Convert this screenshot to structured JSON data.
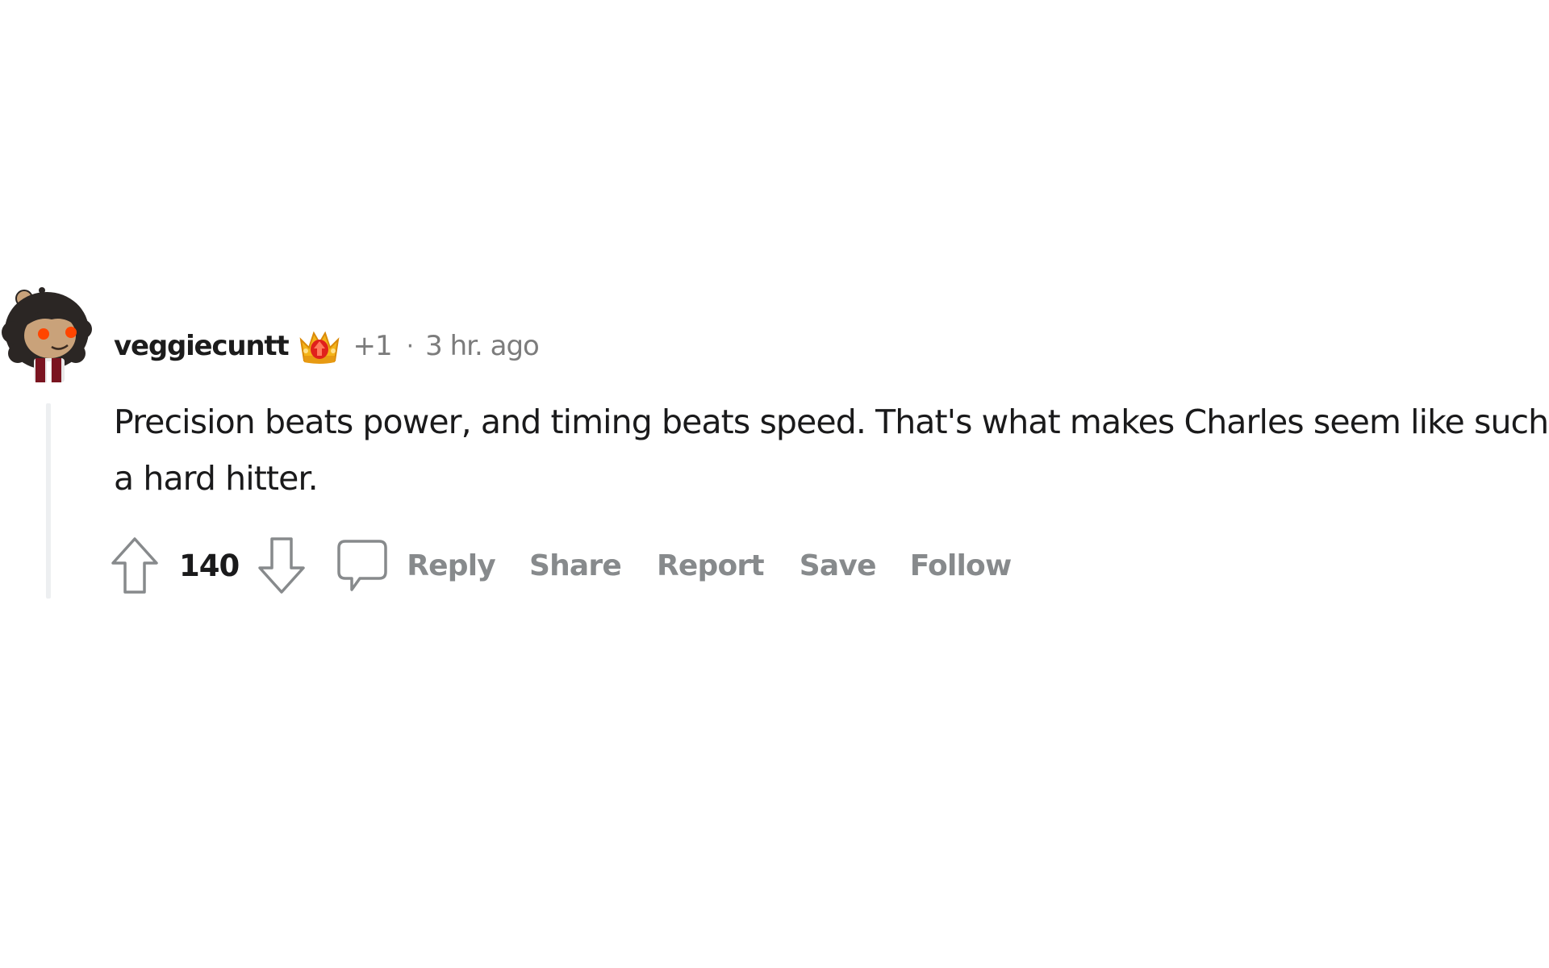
{
  "comment": {
    "author": {
      "username": "veggiecuntt",
      "avatar_icon": "snoo-avatar-icon",
      "award_badge_icon": "crown-award-icon",
      "award_count": "+1"
    },
    "separator": "·",
    "timestamp": "3 hr. ago",
    "body": "Precision beats power, and timing beats speed. That's what makes Charles seem like such a hard hitter.",
    "score": "140",
    "actions": {
      "upvote_icon": "upvote-arrow-icon",
      "downvote_icon": "downvote-arrow-icon",
      "comment_icon": "comment-bubble-icon",
      "reply": "Reply",
      "share": "Share",
      "report": "Report",
      "save": "Save",
      "follow": "Follow"
    }
  },
  "colors": {
    "text_primary": "#1a1a1b",
    "text_meta": "#7c7c7c",
    "action_gray": "#878a8c",
    "thread_line": "#edeff1",
    "snoo_eye": "#ff4500"
  }
}
